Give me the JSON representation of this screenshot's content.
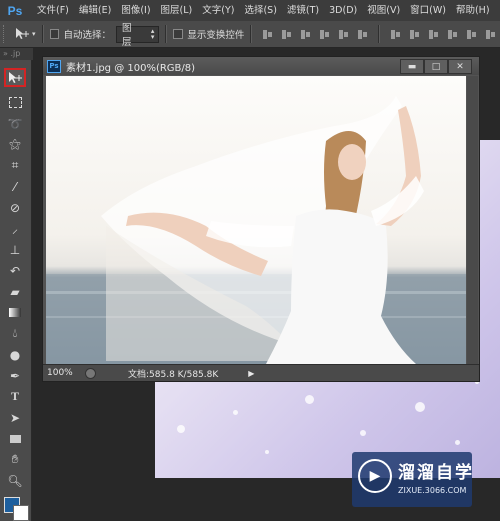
{
  "app": {
    "logo": "Ps",
    "menu": [
      "文件(F)",
      "编辑(E)",
      "图像(I)",
      "图层(L)",
      "文字(Y)",
      "选择(S)",
      "滤镜(T)",
      "3D(D)",
      "视图(V)",
      "窗口(W)",
      "帮助(H)"
    ]
  },
  "options_bar": {
    "auto_select_label": "自动选择：",
    "auto_select_value": "图层",
    "show_transform_label": "显示变换控件"
  },
  "panel_tabs": "» .jp",
  "document": {
    "icon_text": "Ps",
    "title": "素材1.jpg @ 100%(RGB/8)",
    "zoom": "100%",
    "doc_size": "文档:585.8 K/585.8K"
  },
  "watermark": {
    "name": "溜溜自学",
    "url": "ZIXUE.3066.COM"
  },
  "colors": {
    "accent": "#4fa6f2",
    "foreground": "#1d5f9e",
    "background": "#ffffff",
    "highlight": "#d42424"
  }
}
